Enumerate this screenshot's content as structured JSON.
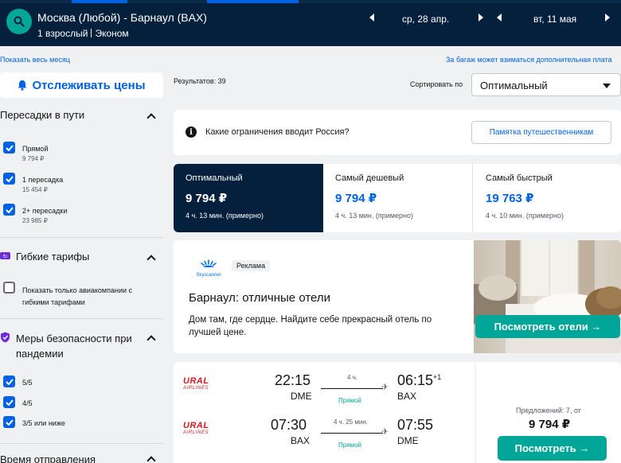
{
  "header": {
    "route": "Москва (Любой) - Барнаул (BAX)",
    "passengers": "1 взрослый",
    "cabin": "Эконом",
    "depart_date": "ср, 28 апр.",
    "return_date": "вт, 11 мая"
  },
  "links": {
    "show_month": "Показать весь месяц",
    "baggage": "За багаж может взиматься дополнительная плата"
  },
  "sidebar": {
    "track_prices": "Отслеживать цены",
    "stops_title": "Пересадки в пути",
    "stops": [
      {
        "label": "Прямой",
        "price": "9 794 ₽",
        "checked": true
      },
      {
        "label": "1 пересадка",
        "price": "15 454 ₽",
        "checked": true
      },
      {
        "label": "2+ пересадки",
        "price": "23 985 ₽",
        "checked": true
      }
    ],
    "flex_title": "Гибкие тарифы",
    "flex_option": "Показать только авиакомпании с гибкими тарифами",
    "safety_title": "Меры безопасности при пандемии",
    "safety": [
      {
        "label": "5/5",
        "checked": true
      },
      {
        "label": "4/5",
        "checked": true
      },
      {
        "label": "3/5 или ниже",
        "checked": true
      }
    ],
    "departure_title": "Время отправления"
  },
  "main": {
    "results": "Результатов: 39",
    "sort_label": "Сортировать по",
    "sort_value": "Оптимальный",
    "info_question": "Какие ограничения вводит Россия?",
    "info_button": "Памятка путешественникам",
    "tabs": [
      {
        "name": "Оптимальный",
        "price": "9 794 ₽",
        "time": "4 ч. 13 мин. (примерно)",
        "active": true
      },
      {
        "name": "Самый дешевый",
        "price": "9 794 ₽",
        "time": "4 ч. 13 мин. (примерно)",
        "active": false
      },
      {
        "name": "Самый быстрый",
        "price": "19 763 ₽",
        "time": "4 ч. 10 мин. (примерно)",
        "active": false
      }
    ],
    "ad": {
      "brand": "Skyscanner",
      "badge": "Реклама",
      "title": "Барнаул: отличные отели",
      "text": "Дом там, где сердце. Найдите себе прекрасный отель по лучшей цене.",
      "button": "Посмотреть отели →"
    },
    "flight": {
      "airline_line1": "URAL",
      "airline_line2": "AIRLINES",
      "legs": [
        {
          "dep_time": "22:15",
          "dep_code": "DME",
          "duration": "4 ч.",
          "stops": "Прямой",
          "arr_time": "06:15",
          "plus": "+1",
          "arr_code": "BAX"
        },
        {
          "dep_time": "07:30",
          "dep_code": "BAX",
          "duration": "4 ч. 25 мин.",
          "stops": "Прямой",
          "arr_time": "07:55",
          "plus": "",
          "arr_code": "DME"
        }
      ],
      "offers": "Предложений: 7, от",
      "price": "9 794 ₽",
      "button": "Посмотреть →"
    }
  },
  "colors": {
    "header_bg": "#05203c",
    "accent_blue": "#0062e3",
    "accent_green": "#00a698",
    "active_tab": "#05203c"
  }
}
